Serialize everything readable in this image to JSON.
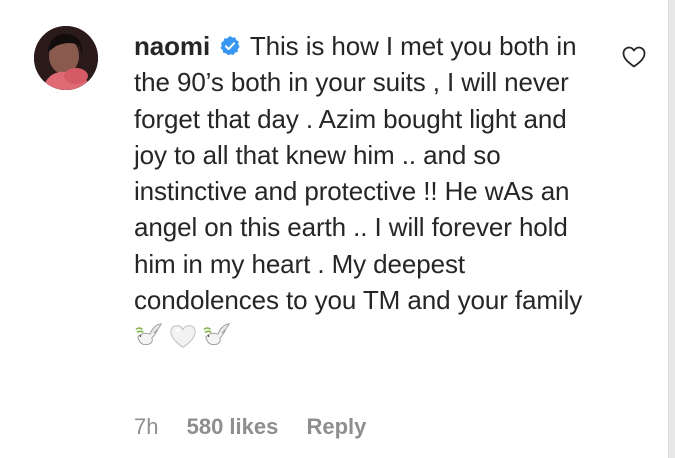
{
  "comment": {
    "username": "naomi",
    "verified": true,
    "text": "This is how I met you both in the 90’s both in your suits , I will never forget that day . Azim bought light and joy to all that knew him .. and so instinctive and protective !! He wAs an angel on this earth .. I will forever hold him in my heart . My deepest condolences to you TM and your family",
    "emojis": [
      "dove-icon",
      "white-heart-icon",
      "dove-icon"
    ]
  },
  "meta": {
    "time": "7h",
    "likes": "580 likes",
    "reply": "Reply"
  },
  "icons": {
    "like": "heart-outline-icon",
    "verified": "verified-badge-icon"
  },
  "colors": {
    "text": "#262626",
    "secondary": "#8e8e8e",
    "verified_blue": "#3897f0"
  }
}
